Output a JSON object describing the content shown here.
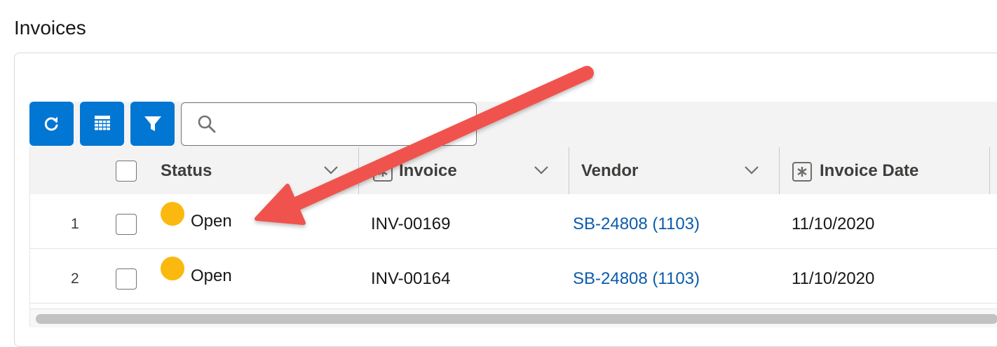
{
  "page": {
    "title": "Invoices"
  },
  "colors": {
    "brand": "#0176d3",
    "status_open": "#fbb90f",
    "link": "#0b5cab",
    "annotation_arrow": "#f0524d"
  },
  "toolbar": {
    "buttons": [
      {
        "icon": "refresh-icon"
      },
      {
        "icon": "column-picker-icon"
      },
      {
        "icon": "filter-icon"
      }
    ],
    "search": {
      "icon": "search-icon",
      "value": "",
      "placeholder": ""
    }
  },
  "table": {
    "columns": [
      {
        "label": "Status",
        "icon": "chevron-down-icon"
      },
      {
        "label": "Invoice",
        "icon": "chevron-down-icon"
      },
      {
        "label": "Vendor",
        "icon": "chevron-down-icon"
      },
      {
        "label": "Invoice Date"
      }
    ],
    "rows": [
      {
        "num": "1",
        "status": "Open",
        "invoice": "INV-00169",
        "vendor": "SB-24808 (1103)",
        "date": "11/10/2020"
      },
      {
        "num": "2",
        "status": "Open",
        "invoice": "INV-00164",
        "vendor": "SB-24808 (1103)",
        "date": "11/10/2020"
      }
    ]
  }
}
